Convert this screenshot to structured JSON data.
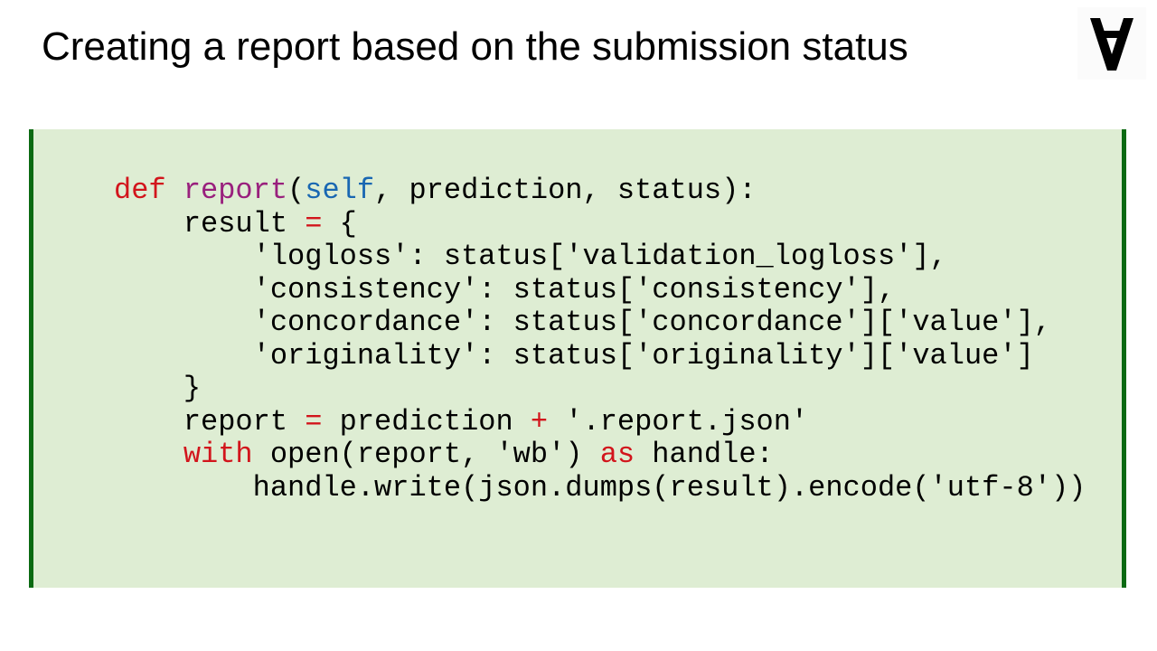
{
  "slide": {
    "title": "Creating a report based on the submission status",
    "logo_icon": "numerai-logo-icon"
  },
  "colors": {
    "panel_background": "#deedd3",
    "panel_border": "#0b6a12",
    "keyword": "#d2151c",
    "function_name": "#99207d",
    "builtin": "#1967b2",
    "operator": "#d2151c",
    "plain": "#000000"
  },
  "code": {
    "language": "python",
    "lines": [
      [
        {
          "type": "keyword",
          "text": "def"
        },
        {
          "type": "plain",
          "text": " "
        },
        {
          "type": "function",
          "text": "report"
        },
        {
          "type": "plain",
          "text": "("
        },
        {
          "type": "builtin",
          "text": "self"
        },
        {
          "type": "plain",
          "text": ", prediction, status):"
        }
      ],
      [
        {
          "type": "plain",
          "text": "    result "
        },
        {
          "type": "operator",
          "text": "="
        },
        {
          "type": "plain",
          "text": " {"
        }
      ],
      [
        {
          "type": "plain",
          "text": "        'logloss': status['validation_logloss'],"
        }
      ],
      [
        {
          "type": "plain",
          "text": "        'consistency': status['consistency'],"
        }
      ],
      [
        {
          "type": "plain",
          "text": "        'concordance': status['concordance']['value'],"
        }
      ],
      [
        {
          "type": "plain",
          "text": "        'originality': status['originality']['value']"
        }
      ],
      [
        {
          "type": "plain",
          "text": "    }"
        }
      ],
      [
        {
          "type": "plain",
          "text": "    report "
        },
        {
          "type": "operator",
          "text": "="
        },
        {
          "type": "plain",
          "text": " prediction "
        },
        {
          "type": "operator",
          "text": "+"
        },
        {
          "type": "plain",
          "text": " '.report.json'"
        }
      ],
      [
        {
          "type": "plain",
          "text": "    "
        },
        {
          "type": "keyword",
          "text": "with"
        },
        {
          "type": "plain",
          "text": " open(report, 'wb') "
        },
        {
          "type": "keyword",
          "text": "as"
        },
        {
          "type": "plain",
          "text": " handle:"
        }
      ],
      [
        {
          "type": "plain",
          "text": "        handle.write(json.dumps(result).encode('utf-8'))"
        }
      ]
    ]
  }
}
